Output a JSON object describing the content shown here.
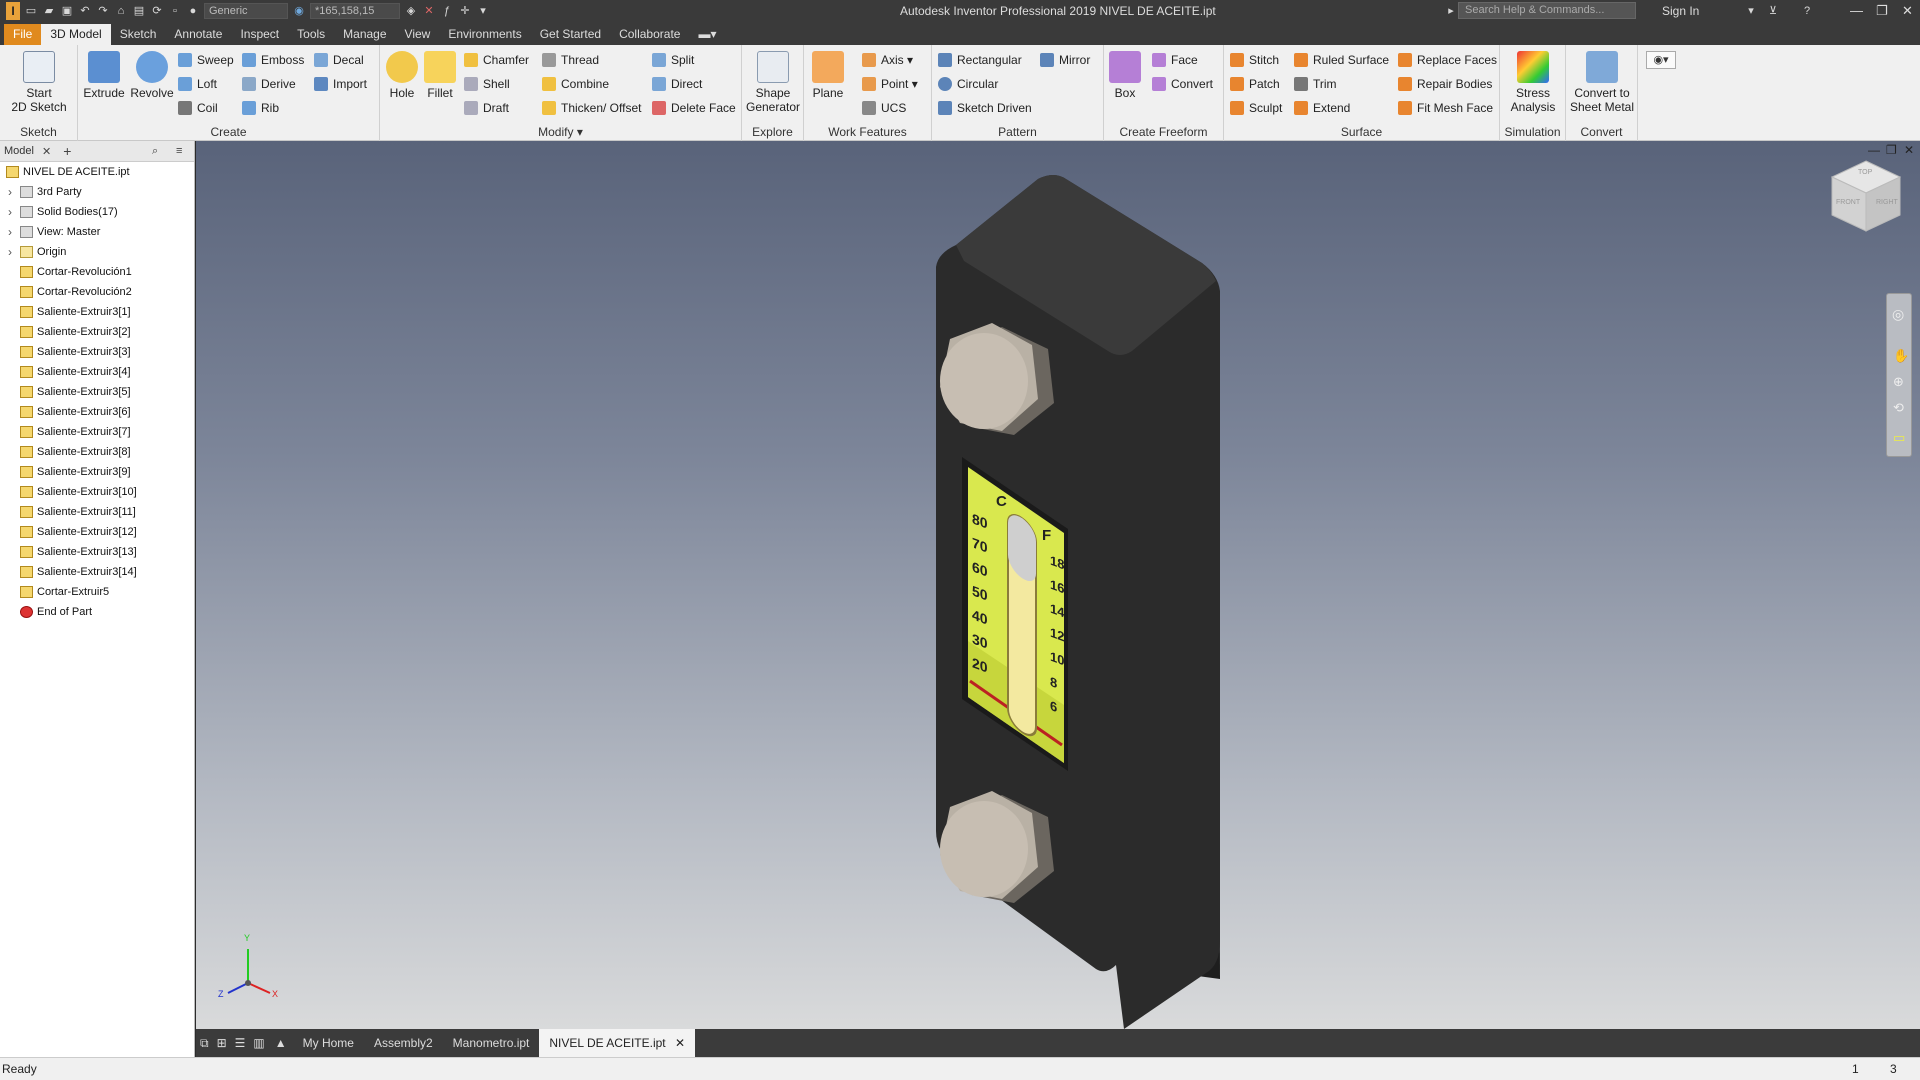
{
  "title": "Autodesk Inventor Professional 2019   NIVEL DE ACEITE.ipt",
  "qat": {
    "appearance": "Generic",
    "color_value": "*165,158,15"
  },
  "search": {
    "placeholder": "Search Help & Commands..."
  },
  "signin": "Sign In",
  "menu": [
    "File",
    "3D Model",
    "Sketch",
    "Annotate",
    "Inspect",
    "Tools",
    "Manage",
    "View",
    "Environments",
    "Get Started",
    "Collaborate"
  ],
  "ribbon": {
    "sketch": {
      "label": "Sketch",
      "start": "Start\n2D Sketch"
    },
    "create": {
      "label": "Create",
      "extrude": "Extrude",
      "revolve": "Revolve",
      "sweep": "Sweep",
      "loft": "Loft",
      "coil": "Coil",
      "emboss": "Emboss",
      "derive": "Derive",
      "rib": "Rib",
      "decal": "Decal",
      "import": "Import"
    },
    "modify": {
      "label": "Modify",
      "hole": "Hole",
      "fillet": "Fillet",
      "chamfer": "Chamfer",
      "shell": "Shell",
      "draft": "Draft",
      "thread": "Thread",
      "combine": "Combine",
      "thicken": "Thicken/ Offset",
      "split": "Split",
      "direct": "Direct",
      "deleteface": "Delete Face"
    },
    "explore": {
      "label": "Explore",
      "shape": "Shape\nGenerator"
    },
    "work": {
      "label": "Work Features",
      "plane": "Plane",
      "axis": "Axis",
      "point": "Point",
      "ucs": "UCS"
    },
    "pattern": {
      "label": "Pattern",
      "rect": "Rectangular",
      "circ": "Circular",
      "sketchdriven": "Sketch Driven",
      "mirror": "Mirror"
    },
    "freeform": {
      "label": "Create Freeform",
      "box": "Box",
      "face": "Face",
      "convert": "Convert"
    },
    "surface": {
      "label": "Surface",
      "stitch": "Stitch",
      "patch": "Patch",
      "sculpt": "Sculpt",
      "ruled": "Ruled Surface",
      "trim": "Trim",
      "extend": "Extend",
      "replace": "Replace Faces",
      "repair": "Repair Bodies",
      "fitmesh": "Fit Mesh Face"
    },
    "simulation": {
      "label": "Simulation",
      "stress": "Stress\nAnalysis"
    },
    "convert": {
      "label": "Convert",
      "sheetmetal": "Convert to\nSheet Metal"
    }
  },
  "browser": {
    "tab": "Model",
    "root": "NIVEL DE ACEITE.ipt",
    "nodes": [
      "3rd Party",
      "Solid Bodies(17)",
      "View: Master",
      "Origin",
      "Cortar-Revolución1",
      "Cortar-Revolución2",
      "Saliente-Extruir3[1]",
      "Saliente-Extruir3[2]",
      "Saliente-Extruir3[3]",
      "Saliente-Extruir3[4]",
      "Saliente-Extruir3[5]",
      "Saliente-Extruir3[6]",
      "Saliente-Extruir3[7]",
      "Saliente-Extruir3[8]",
      "Saliente-Extruir3[9]",
      "Saliente-Extruir3[10]",
      "Saliente-Extruir3[11]",
      "Saliente-Extruir3[12]",
      "Saliente-Extruir3[13]",
      "Saliente-Extruir3[14]",
      "Cortar-Extruir5",
      "End of Part"
    ]
  },
  "gauge": {
    "c": "C",
    "f": "F",
    "c_ticks": [
      "80",
      "70",
      "60",
      "50",
      "40",
      "30",
      "20"
    ],
    "f_ticks": [
      "18",
      "16",
      "14",
      "12",
      "10",
      "8",
      "6"
    ]
  },
  "viewcube": {
    "top": "TOP",
    "front": "FRONT",
    "right": "RIGHT"
  },
  "triad": {
    "x": "X",
    "y": "Y",
    "z": "Z"
  },
  "doctabs": [
    "My Home",
    "Assembly2",
    "Manometro.ipt",
    "NIVEL DE ACEITE.ipt"
  ],
  "status": {
    "text": "Ready",
    "n1": "1",
    "n2": "3"
  }
}
